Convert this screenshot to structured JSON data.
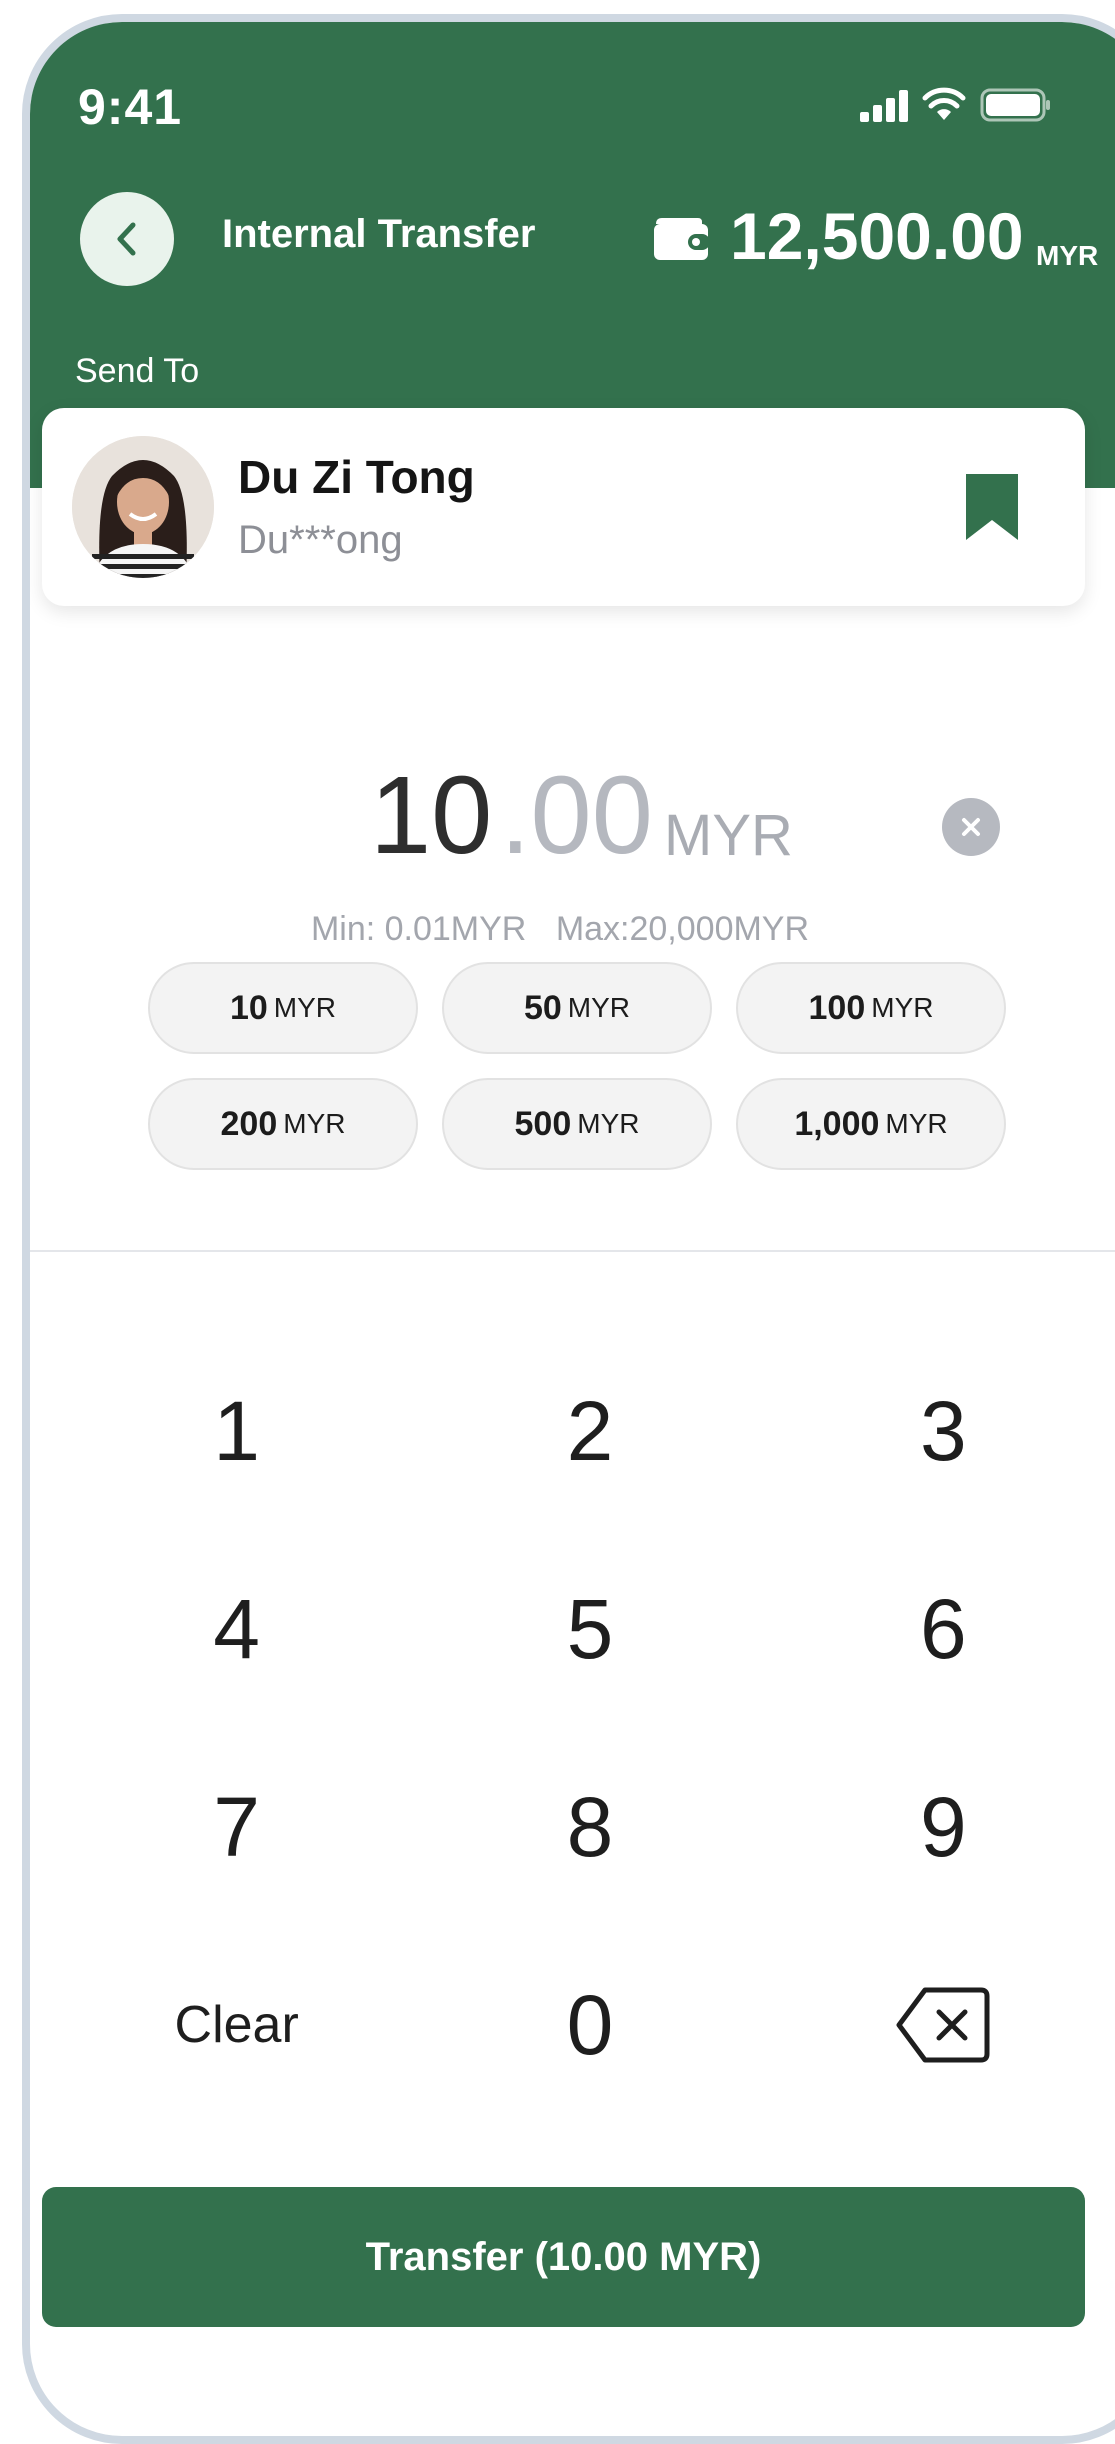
{
  "status_bar": {
    "time": "9:41"
  },
  "header": {
    "title": "Internal Transfer",
    "balance": "12,500.00",
    "balance_unit": "MYR",
    "icons": {
      "back": "chevron-left-icon",
      "wallet": "wallet-icon"
    }
  },
  "send_to": {
    "label": "Send To",
    "name": "Du Zi Tong",
    "masked": "Du***ong",
    "bookmark_icon": "bookmark-icon"
  },
  "amount": {
    "integer": "10",
    "decimal": ".00",
    "unit": "MYR",
    "min": "Min: 0.01MYR",
    "max": "Max:20,000MYR"
  },
  "quick_amounts": [
    {
      "value": "10",
      "unit": "MYR"
    },
    {
      "value": "50",
      "unit": "MYR"
    },
    {
      "value": "100",
      "unit": "MYR"
    },
    {
      "value": "200",
      "unit": "MYR"
    },
    {
      "value": "500",
      "unit": "MYR"
    },
    {
      "value": "1,000",
      "unit": "MYR"
    }
  ],
  "keypad": {
    "k1": "1",
    "k2": "2",
    "k3": "3",
    "k4": "4",
    "k5": "5",
    "k6": "6",
    "k7": "7",
    "k8": "8",
    "k9": "9",
    "clear": "Clear",
    "k0": "0"
  },
  "action": {
    "transfer_label": "Transfer (10.00 MYR)"
  },
  "colors": {
    "primary": "#33714d",
    "chip_bg": "#f3f3f3",
    "muted_text": "#a3a6ad"
  }
}
